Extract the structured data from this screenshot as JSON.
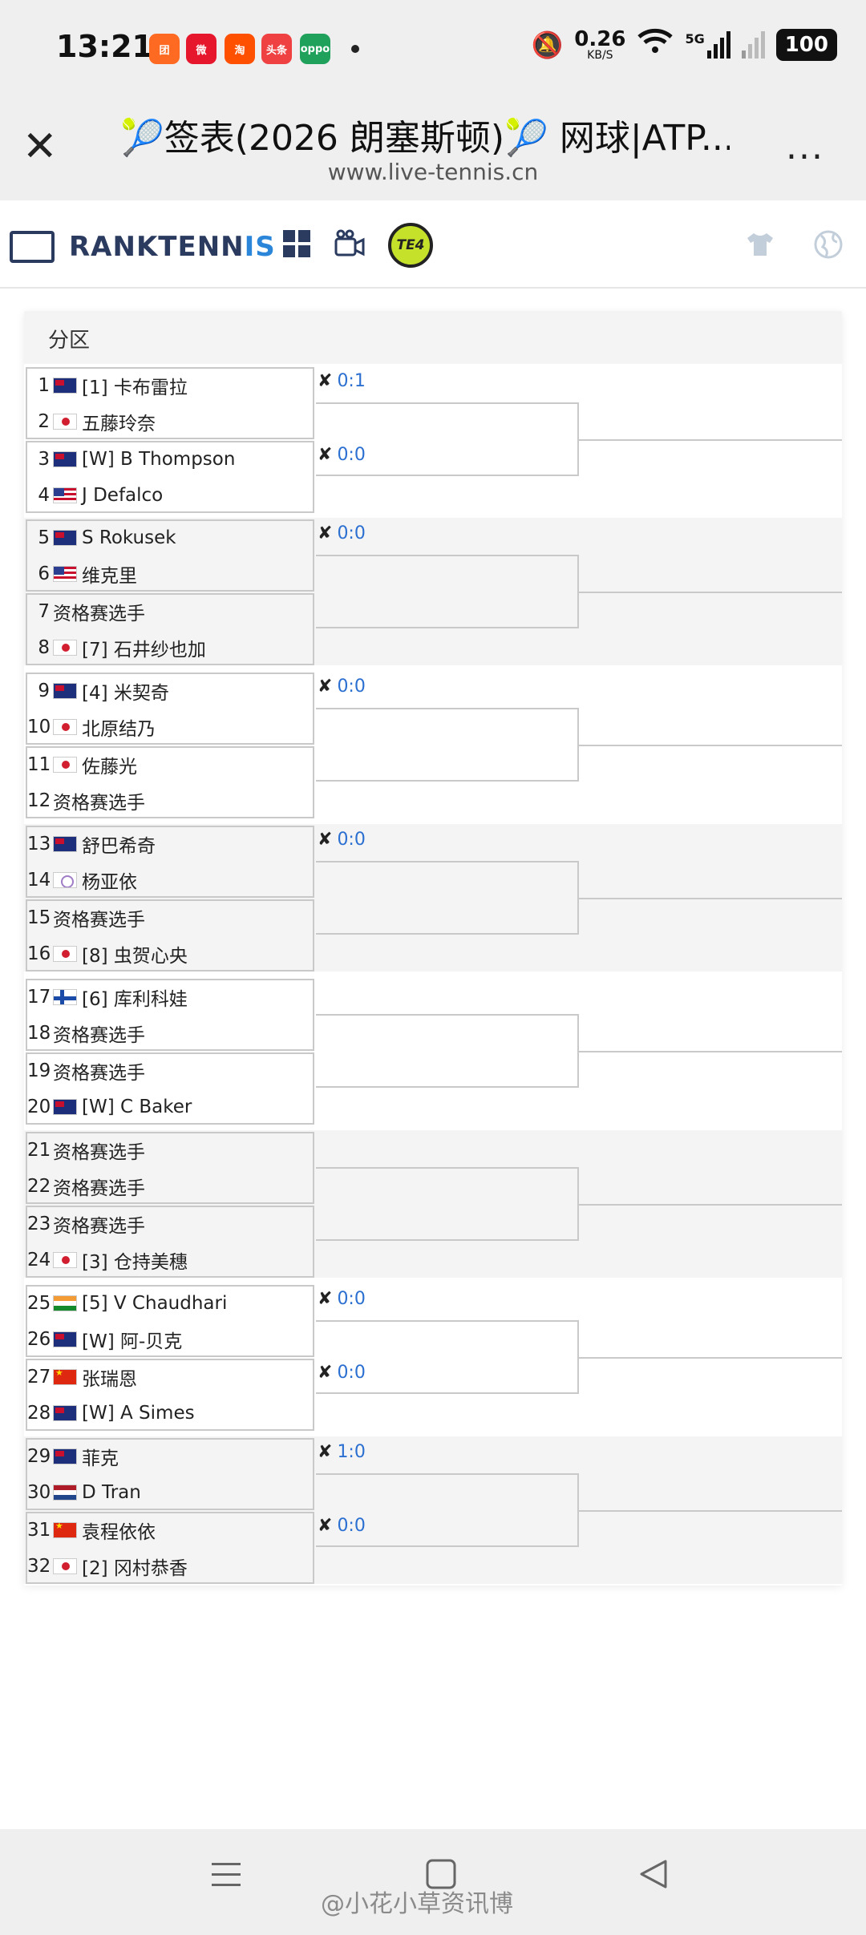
{
  "status_bar": {
    "time": "13:21",
    "net_speed": "0.26",
    "net_unit": "KB/S",
    "network": "5G",
    "battery": "100",
    "apps": [
      {
        "label": "团",
        "color": "#ff6a22"
      },
      {
        "label": "微",
        "color": "#e6162d"
      },
      {
        "label": "淘",
        "color": "#ff5000"
      },
      {
        "label": "头条",
        "color": "#f04142"
      },
      {
        "label": "oppo",
        "color": "#1fa15b"
      }
    ]
  },
  "header": {
    "title": "🎾签表(2026 朗塞斯顿)🎾 网球|ATP...",
    "url": "www.live-tennis.cn",
    "more": "..."
  },
  "nav": {
    "brand_a": "RANKTENN",
    "brand_b": "IS",
    "badge": "TE4"
  },
  "section": {
    "title": "分区"
  },
  "draw": [
    {
      "players": [
        {
          "n": "1",
          "flag": "au",
          "name": "[1] 卡布雷拉"
        },
        {
          "n": "2",
          "flag": "jp",
          "name": "五藤玲奈"
        },
        {
          "n": "3",
          "flag": "au",
          "name": "[W] B Thompson"
        },
        {
          "n": "4",
          "flag": "us",
          "name": "J Defalco"
        }
      ],
      "scores": [
        "0:1",
        "0:0"
      ]
    },
    {
      "players": [
        {
          "n": "5",
          "flag": "au",
          "name": "S Rokusek"
        },
        {
          "n": "6",
          "flag": "us",
          "name": "维克里"
        },
        {
          "n": "7",
          "flag": "",
          "name": "资格赛选手"
        },
        {
          "n": "8",
          "flag": "jp",
          "name": "[7] 石井纱也加"
        }
      ],
      "scores": [
        "0:0"
      ]
    },
    {
      "players": [
        {
          "n": "9",
          "flag": "au",
          "name": "[4] 米契奇"
        },
        {
          "n": "10",
          "flag": "jp",
          "name": "北原结乃"
        },
        {
          "n": "11",
          "flag": "jp",
          "name": "佐藤光"
        },
        {
          "n": "12",
          "flag": "",
          "name": "资格赛选手"
        }
      ],
      "scores": [
        "0:0"
      ]
    },
    {
      "players": [
        {
          "n": "13",
          "flag": "au",
          "name": "舒巴希奇"
        },
        {
          "n": "14",
          "flag": "tw",
          "name": "杨亚依"
        },
        {
          "n": "15",
          "flag": "",
          "name": "资格赛选手"
        },
        {
          "n": "16",
          "flag": "jp",
          "name": "[8] 虫贺心央"
        }
      ],
      "scores": [
        "0:0"
      ]
    },
    {
      "players": [
        {
          "n": "17",
          "flag": "fi",
          "name": "[6] 库利科娃"
        },
        {
          "n": "18",
          "flag": "",
          "name": "资格赛选手"
        },
        {
          "n": "19",
          "flag": "",
          "name": "资格赛选手"
        },
        {
          "n": "20",
          "flag": "au",
          "name": "[W] C Baker"
        }
      ],
      "scores": []
    },
    {
      "players": [
        {
          "n": "21",
          "flag": "",
          "name": "资格赛选手"
        },
        {
          "n": "22",
          "flag": "",
          "name": "资格赛选手"
        },
        {
          "n": "23",
          "flag": "",
          "name": "资格赛选手"
        },
        {
          "n": "24",
          "flag": "jp",
          "name": "[3] 仓持美穗"
        }
      ],
      "scores": []
    },
    {
      "players": [
        {
          "n": "25",
          "flag": "in",
          "name": "[5] V Chaudhari"
        },
        {
          "n": "26",
          "flag": "au",
          "name": "[W] 阿-贝克"
        },
        {
          "n": "27",
          "flag": "cn",
          "name": "张瑞恩"
        },
        {
          "n": "28",
          "flag": "au",
          "name": "[W] A Simes"
        }
      ],
      "scores": [
        "0:0",
        "0:0"
      ]
    },
    {
      "players": [
        {
          "n": "29",
          "flag": "au",
          "name": "菲克"
        },
        {
          "n": "30",
          "flag": "nl",
          "name": "D Tran"
        },
        {
          "n": "31",
          "flag": "cn",
          "name": "袁程依依"
        },
        {
          "n": "32",
          "flag": "jp",
          "name": "[2] 冈村恭香"
        }
      ],
      "scores": [
        "1:0",
        "0:0"
      ]
    }
  ],
  "watermark": "@小花小草资讯博"
}
